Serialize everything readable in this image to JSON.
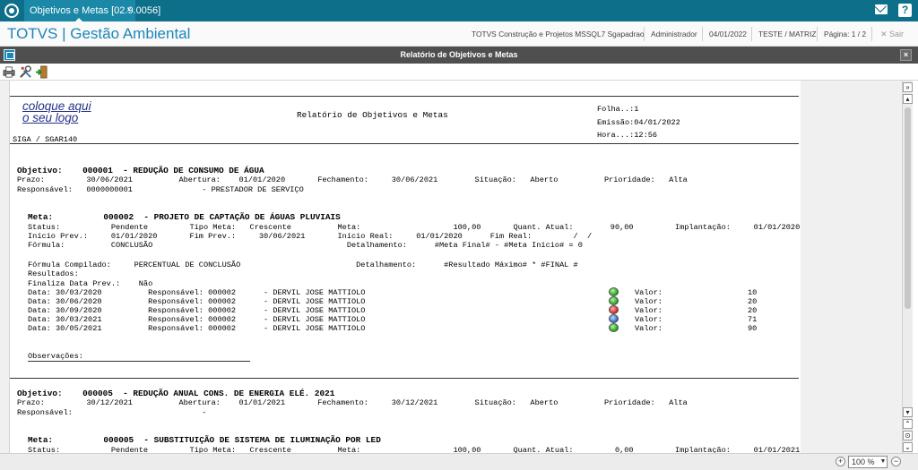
{
  "tab": {
    "label": "Objetivos e Metas [02.9.0056]",
    "close": "×"
  },
  "header": {
    "brand": "TOTVS | Gestão Ambiental",
    "company": "TOTVS Construção e Projetos MSSQL7 Sgapadrao",
    "user": "Administrador",
    "date": "04/01/2022",
    "branch": "TESTE / MATRIZ",
    "page": "Página: 1 / 2",
    "exit": "✕ Sair"
  },
  "window": {
    "title": "Relatório de Objetivos e Metas",
    "close": "×"
  },
  "report": {
    "logo_line1": "coloque aqui",
    "logo_line2": "o seu logo",
    "title": "Relatório de Objetivos e Metas",
    "folha": "Folha..:1",
    "emissao": "Emissão:04/01/2022",
    "hora": "Hora...:12:56",
    "program": "SIGA / SGAR140",
    "obj1": {
      "title": "Objetivo:    000001  - REDUÇÃO DE CONSUMO DE ÁGUA",
      "line1": "Prazo:         30/06/2021          Abertura:    01/01/2020       Fechamento:     30/06/2021        Situação:   Aberto          Prioridade:   Alta",
      "line2": "Responsável:   0000000001               - PRESTADOR DE SERVIÇO"
    },
    "meta1": {
      "title": "Meta:          000002  - PROJETO DE CAPTAÇÃO DE ÁGUAS PLUVIAIS",
      "status": "Status:           Pendente         Tipo Meta:   Crescente          Meta:                    100,00       Quant. Atual:        90,00         Implantação:     01/01/2020",
      "inicio": "Início Prev.:     01/01/2020       Fim Prev.:     30/06/2021       Início Real:     01/01/2020      Fim Real:         /  /",
      "formula": "Fórmula:          CONCLUSÃO                                          Detalhamento:      #Meta Final# - #Meta Início# = 0",
      "compilado": "Fórmula Compilado:     PERCENTUAL DE CONCLUSÃO                         Detalhamento:      #Resultado Máximo# * #FINAL #",
      "resultados": "Resultados:",
      "finaliza": "Finaliza Data Prev.:    Não",
      "rows": [
        {
          "text": "Data: 30/03/2020          Responsável: 000002      - DERVIL JOSE MATTIOLO",
          "valor": "Valor:",
          "num": "10",
          "status": "green"
        },
        {
          "text": "Data: 30/06/2020          Responsável: 000002      - DERVIL JOSE MATTIOLO",
          "valor": "Valor:",
          "num": "20",
          "status": "green"
        },
        {
          "text": "Data: 30/09/2020          Responsável: 000002      - DERVIL JOSE MATTIOLO",
          "valor": "Valor:",
          "num": "20",
          "status": "red"
        },
        {
          "text": "Data: 30/03/2021          Responsável: 000002      - DERVIL JOSE MATTIOLO",
          "valor": "Valor:",
          "num": "71",
          "status": "blue"
        },
        {
          "text": "Data: 30/05/2021          Responsável: 000002      - DERVIL JOSE MATTIOLO",
          "valor": "Valor:",
          "num": "90",
          "status": "green"
        }
      ],
      "observacoes": "Observações:"
    },
    "obj2": {
      "title": "Objetivo:    000005  - REDUÇÃO ANUAL CONS. DE ENERGIA ELÉ. 2021",
      "line1": "Prazo:         30/12/2021          Abertura:    01/01/2021       Fechamento:     30/12/2021        Situação:   Aberto          Prioridade:   Alta",
      "line2": "Responsável:                            -"
    },
    "meta2": {
      "title": "Meta:          000005  - SUBSTITUIÇÃO DE SISTEMA DE ILUMINAÇÃO POR LED",
      "status": "Status:           Pendente         Tipo Meta:   Crescente          Meta:                    100,00       Quant. Atual:         0,00         Implantação:     01/01/2021"
    }
  },
  "zoom": "100 %",
  "colors": {
    "tabbar": "#0d6f8a",
    "brand": "#1d86b8",
    "window_title": "#4f4f4f",
    "logo": "#24328a"
  }
}
